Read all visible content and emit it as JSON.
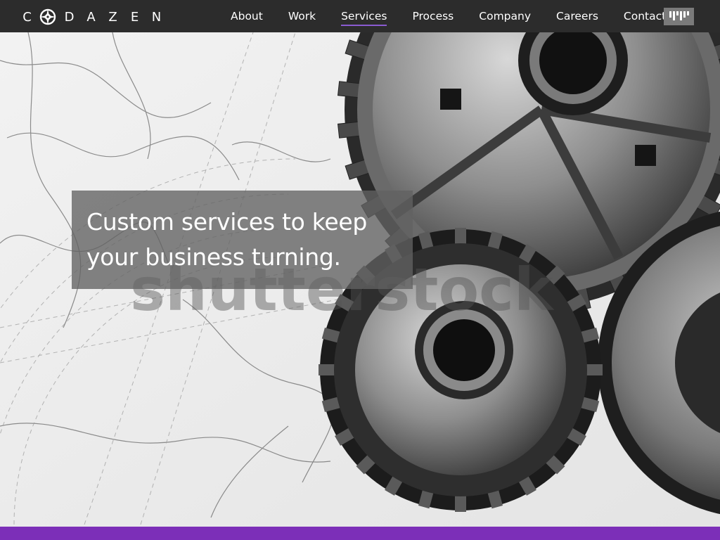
{
  "brand": {
    "name_letters": [
      "C",
      "D",
      "A",
      "Z",
      "E",
      "N"
    ],
    "logo_icon": "compass-o-icon"
  },
  "nav": {
    "items": [
      {
        "label": "About",
        "active": false
      },
      {
        "label": "Work",
        "active": false
      },
      {
        "label": "Services",
        "active": true
      },
      {
        "label": "Process",
        "active": false
      },
      {
        "label": "Company",
        "active": false
      },
      {
        "label": "Careers",
        "active": false
      },
      {
        "label": "Contact",
        "active": false
      }
    ],
    "menu_icon": "bars-menu-icon"
  },
  "hero": {
    "headline_lines": [
      "Custom services to keep",
      "your business turning."
    ],
    "watermark": "shutterstock",
    "image_subject": "gears-over-technical-drawing"
  },
  "colors": {
    "nav_bg": "#2c2c2c",
    "accent": "#8a5bd1",
    "footer_bar": "#7c2fb8",
    "headline_box": "#626262",
    "menu_button": "#7a7a7a"
  }
}
